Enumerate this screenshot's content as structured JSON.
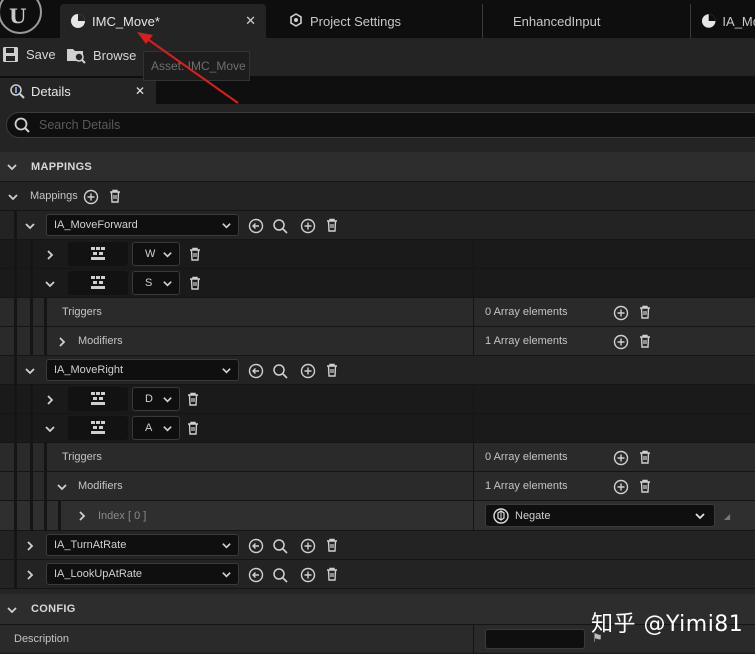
{
  "tabs": [
    {
      "label": "IMC_Move*",
      "icon": "imc-icon"
    },
    {
      "label": "Project Settings",
      "icon": "settings-icon"
    },
    {
      "label": "EnhancedInput",
      "icon": ""
    },
    {
      "label": "IA_Mo",
      "icon": "imc-icon"
    }
  ],
  "toolbar": {
    "save_label": "Save",
    "browse_label": "Browse",
    "tooltip": "Asset: IMC_Move"
  },
  "details": {
    "tab_label": "Details",
    "search_placeholder": "Search Details"
  },
  "mappings": {
    "section_label": "MAPPINGS",
    "mappings_label": "Mappings",
    "actions": [
      {
        "name": "IA_MoveForward",
        "keys": [
          {
            "key": "W",
            "expanded": false
          },
          {
            "key": "S",
            "expanded": true,
            "triggers_label": "Triggers",
            "triggers_value": "0 Array elements",
            "modifiers_label": "Modifiers",
            "modifiers_value": "1 Array elements"
          }
        ]
      },
      {
        "name": "IA_MoveRight",
        "keys": [
          {
            "key": "D",
            "expanded": false
          },
          {
            "key": "A",
            "expanded": true,
            "triggers_label": "Triggers",
            "triggers_value": "0 Array elements",
            "modifiers_label": "Modifiers",
            "modifiers_value": "1 Array elements",
            "index_label": "Index [ 0 ]",
            "modifier_value": "Negate"
          }
        ]
      },
      {
        "name": "IA_TurnAtRate"
      },
      {
        "name": "IA_LookUpAtRate"
      }
    ]
  },
  "config": {
    "section_label": "CONFIG",
    "description_label": "Description"
  },
  "watermark": "知乎 @Yimi81",
  "colors": {
    "accent_arrow": "#d81e1e",
    "panel": "#242424",
    "background": "#151515"
  }
}
